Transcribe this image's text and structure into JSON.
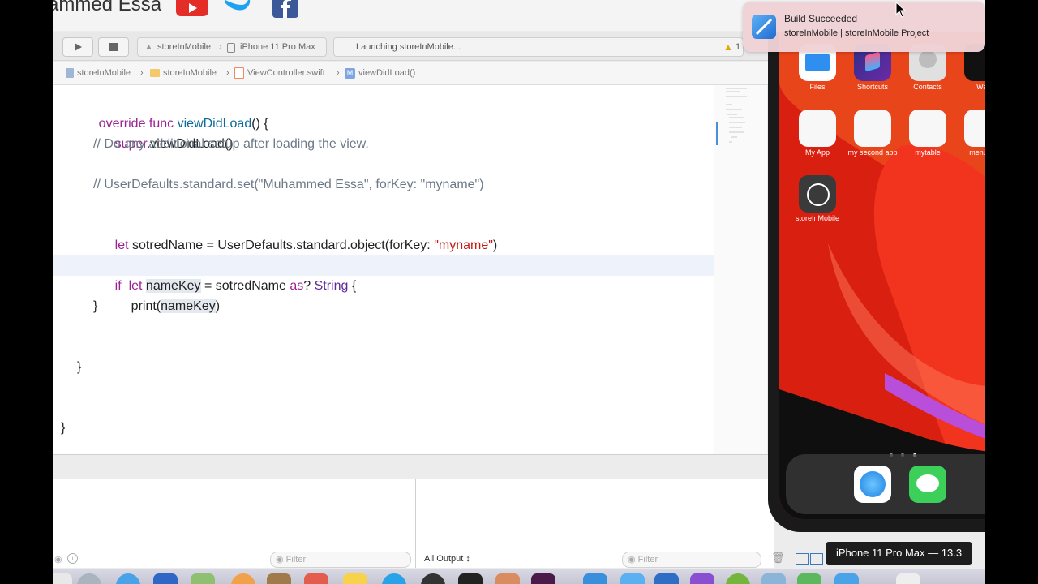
{
  "banner": {
    "name": "ammed Essa"
  },
  "toolbar": {
    "project": "storeInMobile",
    "device": "iPhone 11 Pro Max",
    "status": "Launching storeInMobile...",
    "warning_count": "1"
  },
  "jumpbar": {
    "items": [
      "storeInMobile",
      "storeInMobile",
      "ViewController.swift",
      "viewDidLoad()"
    ]
  },
  "code": {
    "l1_kw": "override func ",
    "l1_fn": "viewDidLoad",
    "l1_rest": "() {",
    "l2_kw": "super",
    "l2_rest": ".viewDidLoad()",
    "l3": "// Do any additional setup after loading the view.",
    "l5": "// UserDefaults.standard.set(\"Muhammed Essa\", forKey: \"myname\")",
    "l7_kw": "let",
    "l7_rest": " sotredName = UserDefaults.standard.object(forKey: ",
    "l7_str": "\"myname\"",
    "l7_end": ")",
    "l9_if": "if",
    "l9_let": "let",
    "l9_var": "nameKey",
    "l9_mid": " = sotredName ",
    "l9_as": "as",
    "l9_q": "? ",
    "l9_type": "String",
    "l9_end": " {",
    "l10_a": "print(",
    "l10_b": "nameKey",
    "l10_c": ")",
    "l11": "}",
    "l14": "}",
    "l17": "}"
  },
  "debug": {
    "filter_left": "Filter",
    "output_select": "All Output ↕",
    "filter_right": "Filter"
  },
  "notification": {
    "title": "Build Succeeded",
    "subtitle": "storeInMobile | storeInMobile Project"
  },
  "apps": {
    "row1": [
      "Files",
      "Shortcuts",
      "Contacts",
      "Wat"
    ],
    "row2": [
      "My App",
      "my second app",
      "mytable",
      "menuBa"
    ],
    "row3": [
      "storeInMobile"
    ]
  },
  "tooltip": "iPhone 11 Pro Max — 13.3",
  "colors": {
    "keyword": "#9b2393",
    "function": "#0b6a9c",
    "comment": "#6c7986",
    "string": "#c41a16",
    "type": "#5d2b9c",
    "wallpaper": "#d81f10"
  }
}
